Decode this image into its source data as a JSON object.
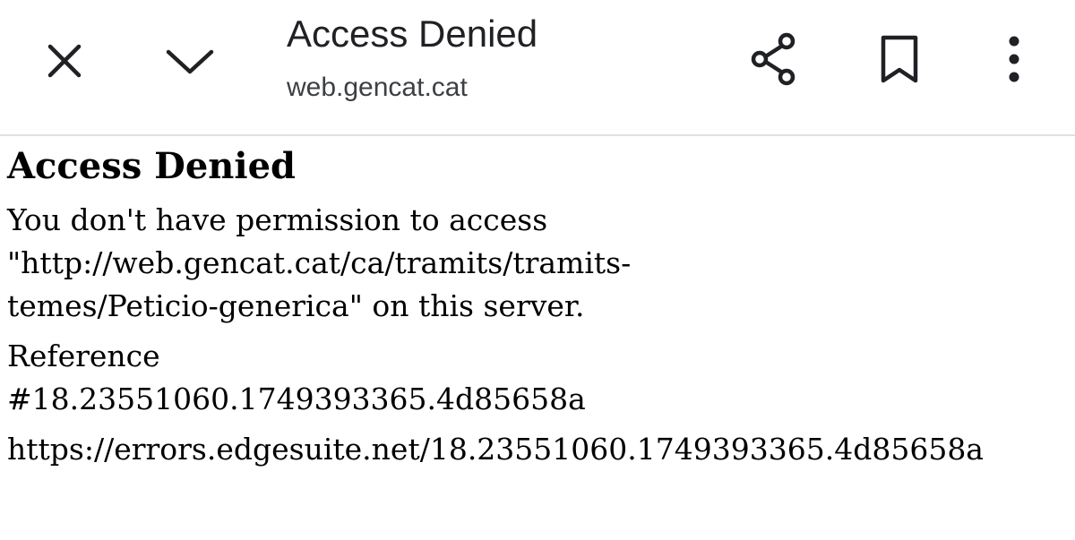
{
  "toolbar": {
    "title": "Access Denied",
    "domain": "web.gencat.cat",
    "icons": {
      "close": "close-icon",
      "minimize": "chevron-down-icon",
      "share": "share-icon",
      "bookmark": "bookmark-icon",
      "menu": "more-vert-icon"
    }
  },
  "page": {
    "heading": "Access Denied",
    "message": "You don't have permission to access\n\"http://web.gencat.cat/ca/tramits/tramits-\ntemes/Peticio-generica\" on this server.",
    "reference": "Reference\n#18.23551060.1749393365.4d85658a",
    "error_url": "https://errors.edgesuite.net/18.23551060.1749393365.4d85658a"
  },
  "colors": {
    "text": "#000000",
    "toolbar_text": "#202124",
    "icon": "#202124",
    "divider": "#e0e0e0"
  }
}
